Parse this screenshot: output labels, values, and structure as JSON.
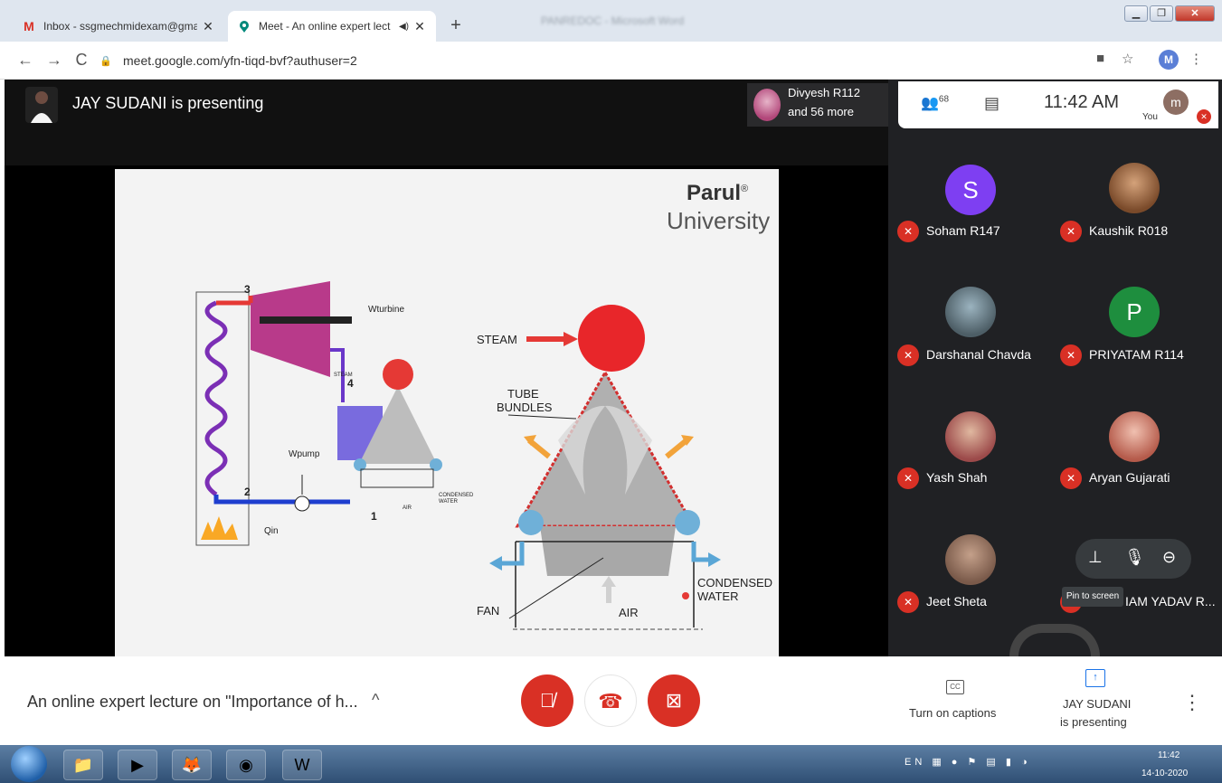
{
  "browser": {
    "tabs": [
      {
        "title": "Inbox - ssgmechmidexam@gma",
        "active": false
      },
      {
        "title": "Meet - An online expert lect",
        "active": true
      }
    ],
    "url": "meet.google.com/yfn-tiqd-bvf?authuser=2",
    "profile_initial": "M",
    "window_title": "PANREDOC - Microsoft Word"
  },
  "meet": {
    "presenter_banner": "JAY SUDANI is presenting",
    "participants_chip": {
      "line1": "Divyesh R112",
      "line2": "and 56 more"
    },
    "participant_count": "68",
    "time": "11:42 AM",
    "self_label": "You",
    "self_initial": "m",
    "slide": {
      "brand_top": "Parul",
      "brand_mark": "®",
      "brand_bottom": "University",
      "labels_left": {
        "p3": "3",
        "p4": "4",
        "p2": "2",
        "p1": "1",
        "turbine": "Wturbine",
        "pump": "Wpump",
        "qin": "Qin",
        "steam_small": "STEAM",
        "air_small": "AIR",
        "condensed_small": "CONDENSED WATER"
      },
      "labels_right": {
        "steam": "STEAM",
        "tube1": "TUBE",
        "tube2": "BUNDLES",
        "fan": "FAN",
        "air": "AIR",
        "condensed1": "CONDENSED",
        "condensed2": "WATER"
      }
    },
    "participants": [
      {
        "name": "Soham R147",
        "initial": "S",
        "color": "#7e3ff2"
      },
      {
        "name": "Kaushik R018",
        "initial": "",
        "color": "#c98b58"
      },
      {
        "name": "Darshanal Chavda",
        "initial": "",
        "color": "#6b7d86"
      },
      {
        "name": "PRIYATAM R114",
        "initial": "P",
        "color": "#1e8e3e"
      },
      {
        "name": "Yash Shah",
        "initial": "",
        "color": "#9c4a4a"
      },
      {
        "name": "Aryan Gujarati",
        "initial": "",
        "color": "#b55b4b"
      },
      {
        "name": "Jeet Sheta",
        "initial": "",
        "color": "#7a5a4a"
      },
      {
        "name": "IAM YADAV R...",
        "initial": "",
        "color": "#333333"
      }
    ],
    "tooltip": "Pin to screen",
    "meeting_title": "An online expert lecture on \"Importance of h...",
    "captions_label": "Turn on captions",
    "presenting_line1": "JAY SUDANI",
    "presenting_line2": "is presenting"
  },
  "taskbar": {
    "time": "11:42",
    "date": "14-10-2020",
    "lang": "EN"
  }
}
